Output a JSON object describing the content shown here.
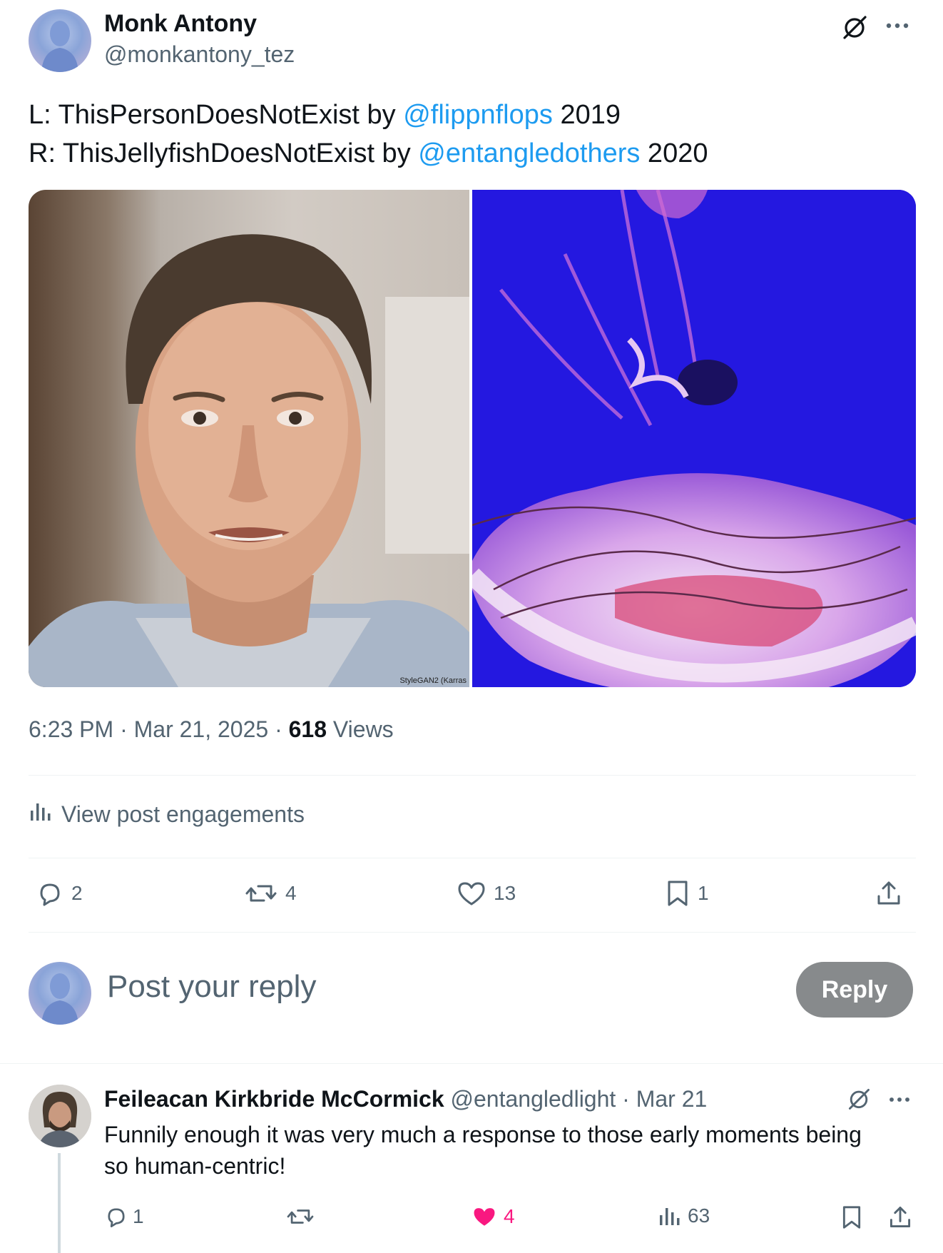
{
  "post": {
    "author_name": "Monk Antony",
    "author_handle": "@monkantony_tez",
    "line1_prefix": "L: ThisPersonDoesNotExist by ",
    "line1_mention": "@flippnflops",
    "line1_suffix": " 2019",
    "line2_prefix": "R: ThisJellyfishDoesNotExist by ",
    "line2_mention": "@entangledothers",
    "line2_suffix": " 2020",
    "watermark": "StyleGAN2 (Karras",
    "time": "6:23 PM",
    "date": "Mar 21, 2025",
    "views_count": "618",
    "views_label": "Views",
    "engagements_label": "View post engagements",
    "stats": {
      "replies": "2",
      "reposts": "4",
      "likes": "13",
      "bookmarks": "1"
    }
  },
  "reply_box": {
    "placeholder": "Post your reply",
    "button_label": "Reply"
  },
  "reply": {
    "author_name": "Feileacan Kirkbride McCormick",
    "author_handle": "@entangledlight",
    "date": "Mar 21",
    "text_line1": "Funnily enough it was very much a response to those early moments being",
    "text_line2": "so human-centric!",
    "stats": {
      "replies": "1",
      "likes": "4",
      "views": "63"
    }
  },
  "colors": {
    "link": "#1d9bf0",
    "muted": "#536471",
    "like_active": "#f91880",
    "reply_button": "#878a8c"
  },
  "icons": [
    "grok-icon",
    "more-icon",
    "analytics-icon",
    "reply-icon",
    "repost-icon",
    "like-icon",
    "bookmark-icon",
    "share-icon"
  ]
}
